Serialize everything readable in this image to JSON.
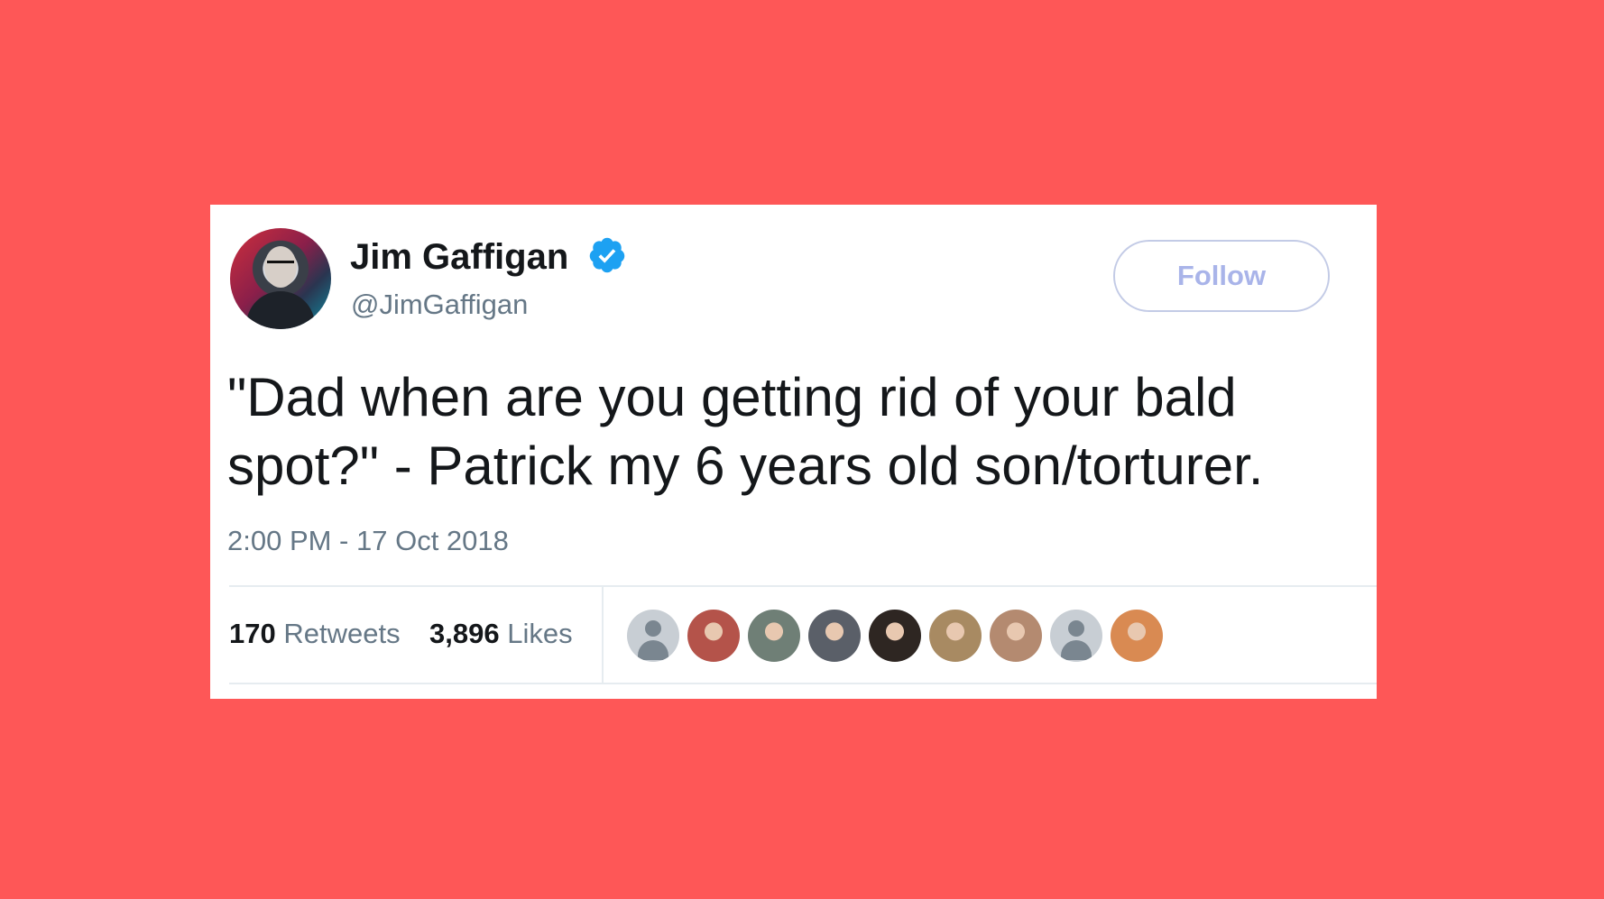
{
  "page": {
    "background_color": "#fe5757"
  },
  "tweet": {
    "author_name": "Jim Gaffigan",
    "author_handle": "@JimGaffigan",
    "verified_color": "#1da1f2",
    "follow_label": "Follow",
    "text": "\"Dad when are you getting rid of your bald spot?\" - Patrick my 6 years old son/torturer.",
    "timestamp": "2:00 PM - 17 Oct 2018",
    "retweets_count": "170",
    "retweets_label": "Retweets",
    "likes_count": "3,896",
    "likes_label": "Likes",
    "likers": [
      {
        "type": "default",
        "color": "#c8ced4"
      },
      {
        "type": "photo",
        "color": "#b4534a"
      },
      {
        "type": "photo",
        "color": "#6f7f76"
      },
      {
        "type": "photo",
        "color": "#5a5f68"
      },
      {
        "type": "photo",
        "color": "#2e2622"
      },
      {
        "type": "photo",
        "color": "#a88a62"
      },
      {
        "type": "photo",
        "color": "#b48a70"
      },
      {
        "type": "default",
        "color": "#c8ced4"
      },
      {
        "type": "photo",
        "color": "#d98a52"
      }
    ]
  }
}
